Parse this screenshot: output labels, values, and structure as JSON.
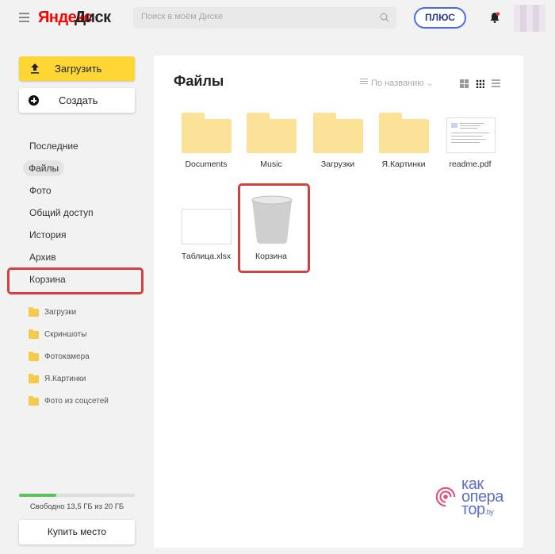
{
  "header": {
    "logo_brand": "Яндекс",
    "logo_product": "Диск",
    "search_placeholder": "Поиск в моём Диске",
    "plus_label": "ПЛЮС"
  },
  "sidebar": {
    "upload_label": "Загрузить",
    "create_label": "Создать",
    "nav": [
      {
        "label": "Последние",
        "active": false
      },
      {
        "label": "Файлы",
        "active": true
      },
      {
        "label": "Фото",
        "active": false
      },
      {
        "label": "Общий доступ",
        "active": false
      },
      {
        "label": "История",
        "active": false
      },
      {
        "label": "Архив",
        "active": false
      },
      {
        "label": "Корзина",
        "active": false,
        "highlighted": true
      }
    ],
    "folders": [
      "Загрузки",
      "Скриншоты",
      "Фотокамера",
      "Я.Картинки",
      "Фото из соцсетей"
    ],
    "quota_text": "Свободно 13,5 ГБ из 20 ГБ",
    "quota_used_fraction": 0.325,
    "buy_label": "Купить место"
  },
  "main": {
    "title": "Файлы",
    "sort_label": "По названию",
    "items": [
      {
        "name": "Documents",
        "kind": "folder"
      },
      {
        "name": "Music",
        "kind": "folder"
      },
      {
        "name": "Загрузки",
        "kind": "folder"
      },
      {
        "name": "Я.Картинки",
        "kind": "folder"
      },
      {
        "name": "readme.pdf",
        "kind": "pdf"
      },
      {
        "name": "Таблица.xlsx",
        "kind": "xlsx"
      },
      {
        "name": "Корзина",
        "kind": "trash",
        "highlighted": true
      }
    ]
  },
  "watermark": {
    "line1": "как",
    "line2": "опера",
    "line3": "тор",
    "suffix": ".by"
  },
  "colors": {
    "accent_yellow": "#ffd633",
    "plus_blue": "#4a6ae8",
    "highlight_red": "#d44040",
    "folder_yellow": "#fbe298",
    "quota_green": "#5bc35b",
    "watermark_blue": "#5d6fc7"
  },
  "icons": [
    "menu-icon",
    "search-icon",
    "bell-icon",
    "upload-icon",
    "plus-icon",
    "folder-icon",
    "sort-icon",
    "tiles-large-icon",
    "tiles-small-icon",
    "list-icon",
    "trash-bin-icon"
  ]
}
